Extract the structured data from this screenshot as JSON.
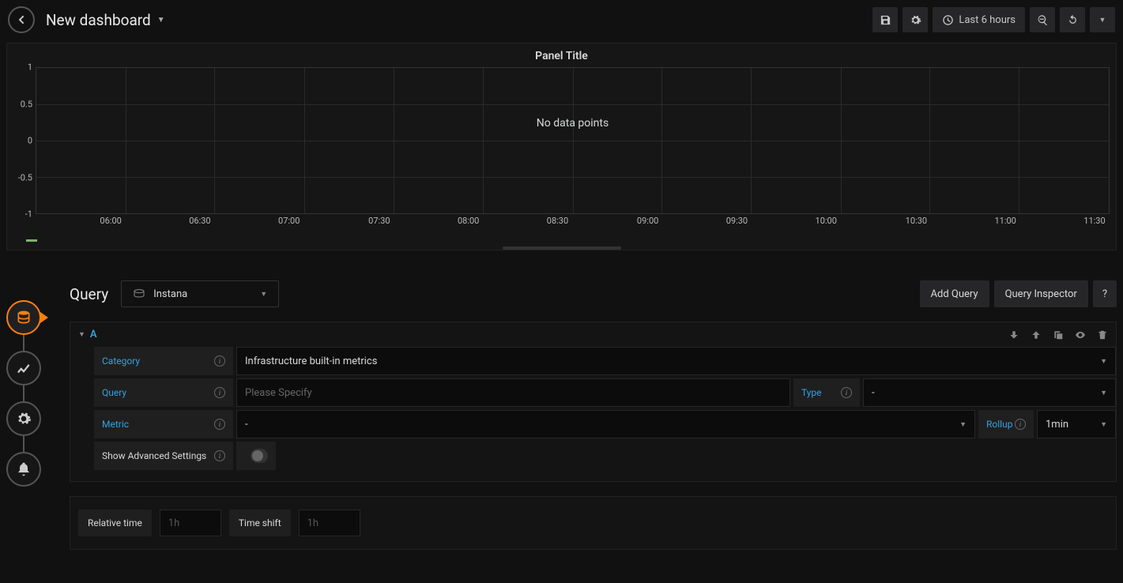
{
  "header": {
    "title": "New dashboard",
    "time_range": "Last 6 hours"
  },
  "panel": {
    "title": "Panel Title",
    "no_data": "No data points"
  },
  "chart_data": {
    "type": "line",
    "title": "Panel Title",
    "xlabel": "",
    "ylabel": "",
    "ylim": [
      -1.0,
      1.0
    ],
    "yticks": [
      -1.0,
      -0.5,
      0,
      0.5,
      1.0
    ],
    "xticks": [
      "06:00",
      "06:30",
      "07:00",
      "07:30",
      "08:00",
      "08:30",
      "09:00",
      "09:30",
      "10:00",
      "10:30",
      "11:00",
      "11:30"
    ],
    "series": [],
    "annotation": "No data points"
  },
  "sidebar": {
    "items": [
      "queries",
      "visualization",
      "general",
      "alert"
    ]
  },
  "query": {
    "section_title": "Query",
    "datasource": "Instana",
    "add_query": "Add Query",
    "inspector": "Query Inspector",
    "help": "?",
    "row_label": "A",
    "fields": {
      "category_label": "Category",
      "category_value": "Infrastructure built-in metrics",
      "query_label": "Query",
      "query_placeholder": "Please Specify",
      "type_label": "Type",
      "type_value": "-",
      "metric_label": "Metric",
      "metric_value": "-",
      "rollup_label": "Rollup",
      "rollup_value": "1min",
      "advanced_label": "Show Advanced Settings"
    }
  },
  "time_options": {
    "relative_label": "Relative time",
    "relative_placeholder": "1h",
    "shift_label": "Time shift",
    "shift_placeholder": "1h"
  }
}
